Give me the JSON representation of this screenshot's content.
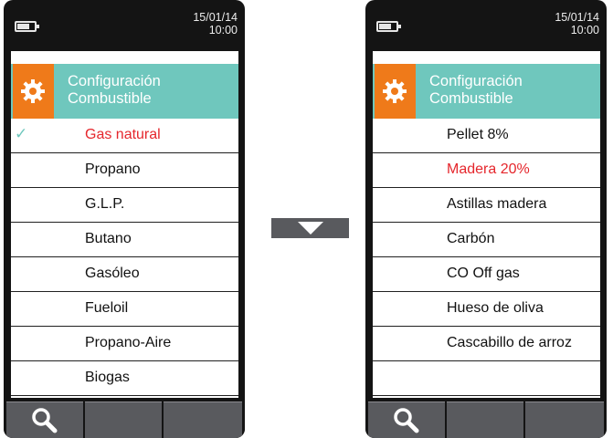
{
  "screens": [
    {
      "date": "15/01/14",
      "time": "10:00",
      "title_line1": "Configuración",
      "title_line2": "Combustible",
      "items": [
        {
          "label": "Gas natural",
          "selected": true,
          "checked": true
        },
        {
          "label": "Propano",
          "selected": false,
          "checked": false
        },
        {
          "label": "G.L.P.",
          "selected": false,
          "checked": false
        },
        {
          "label": "Butano",
          "selected": false,
          "checked": false
        },
        {
          "label": "Gasóleo",
          "selected": false,
          "checked": false
        },
        {
          "label": "Fueloil",
          "selected": false,
          "checked": false
        },
        {
          "label": "Propano-Aire",
          "selected": false,
          "checked": false
        },
        {
          "label": "Biogas",
          "selected": false,
          "checked": false
        }
      ]
    },
    {
      "date": "15/01/14",
      "time": "10:00",
      "title_line1": "Configuración",
      "title_line2": "Combustible",
      "items": [
        {
          "label": "Pellet 8%",
          "selected": false,
          "checked": false
        },
        {
          "label": "Madera 20%",
          "selected": true,
          "checked": false
        },
        {
          "label": "Astillas madera",
          "selected": false,
          "checked": false
        },
        {
          "label": "Carbón",
          "selected": false,
          "checked": false
        },
        {
          "label": "CO Off gas",
          "selected": false,
          "checked": false
        },
        {
          "label": "Hueso de oliva",
          "selected": false,
          "checked": false
        },
        {
          "label": "Cascabillo de arroz",
          "selected": false,
          "checked": false
        },
        {
          "label": "",
          "selected": false,
          "checked": false
        }
      ]
    }
  ],
  "check_glyph": "✓",
  "icons": {
    "settings": "gear-icon",
    "search": "search-icon",
    "scroll": "triangle-down-icon",
    "battery": "battery-icon",
    "check": "checkmark-icon"
  },
  "colors": {
    "accent": "#6fc7bd",
    "gear_box": "#ef7a1a",
    "selected_text": "#e5262c",
    "softkey": "#595a5e",
    "device": "#141414"
  }
}
